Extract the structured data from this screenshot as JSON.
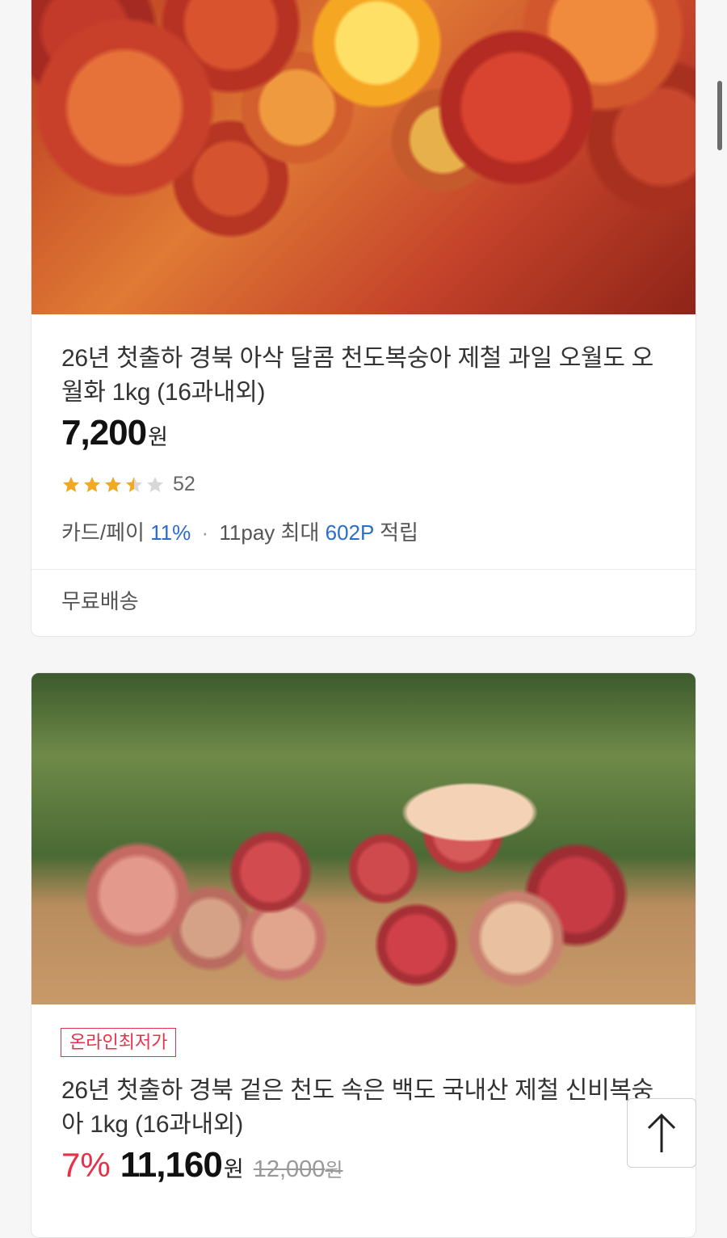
{
  "products": [
    {
      "title": "26년 첫출하 경북 아삭 달콤 천도복숭아 제철 과일 오월도 오월화 1kg (16과내외)",
      "price": "7,200",
      "currency_unit": "원",
      "rating": 3.5,
      "review_count": "52",
      "benefit": {
        "card_label": "카드/페이",
        "card_rate": "11%",
        "pay_label": "11pay 최대",
        "points": "602P",
        "suffix": "적립"
      },
      "shipping": "무료배송",
      "image_icon": "nectarine-photo"
    },
    {
      "badge": "온라인최저가",
      "title": "26년 첫출하 경북 겉은 천도 속은 백도 국내산 제철 신비복숭아 1kg (16과내외)",
      "discount": "7%",
      "price": "11,160",
      "currency_unit": "원",
      "original_price": "12,000",
      "original_unit": "원",
      "image_icon": "peach-hand-photo"
    }
  ],
  "colors": {
    "accent_red": "#e5324a",
    "benefit_blue": "#2a6dcb",
    "star": "#f2a922"
  },
  "scroll_top_icon": "arrow-up-icon"
}
